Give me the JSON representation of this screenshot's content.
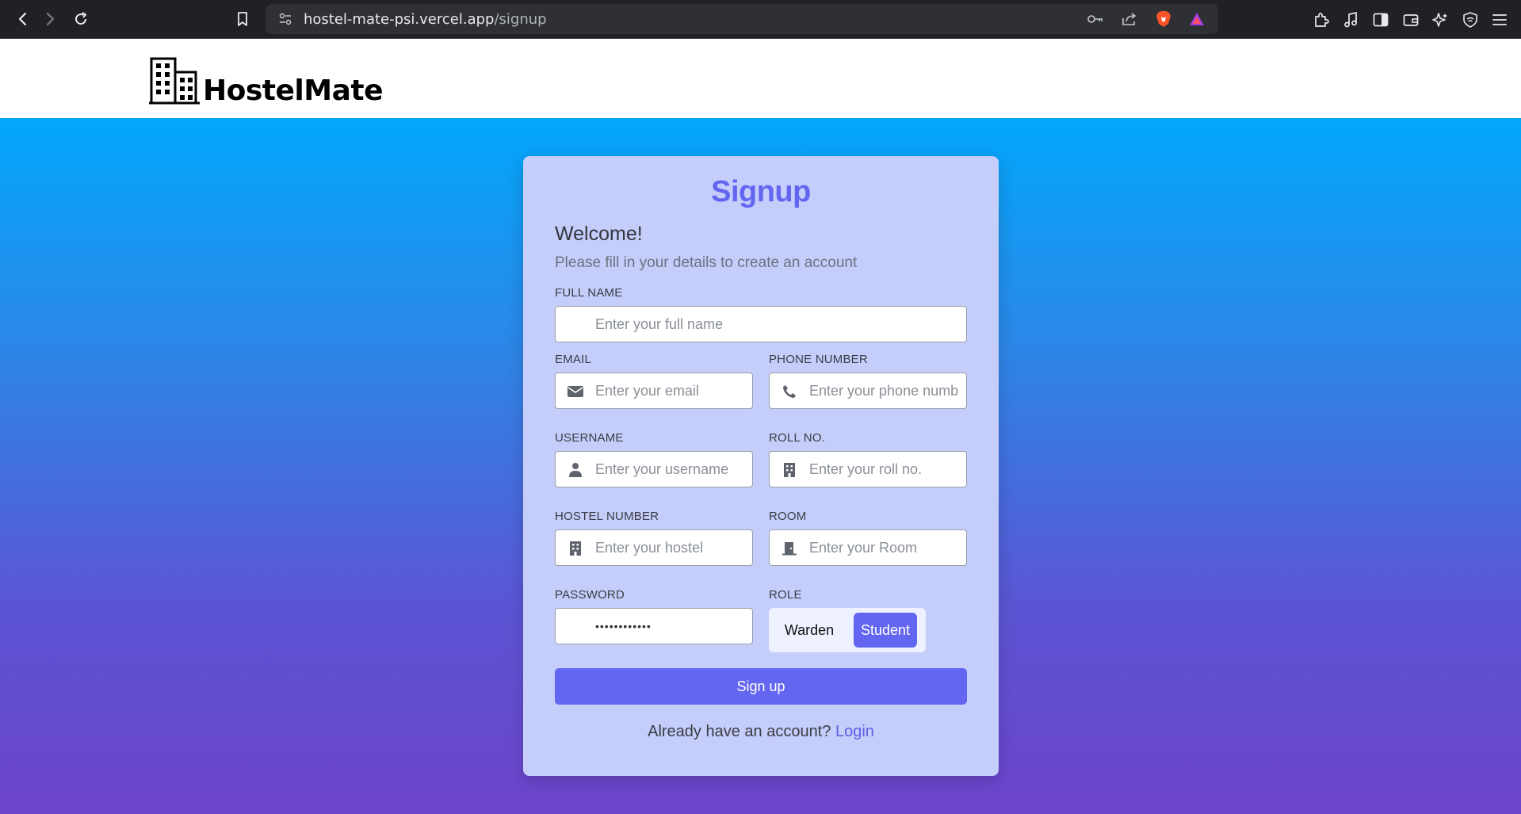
{
  "browser": {
    "url_domain": "hostel-mate-psi.vercel.app",
    "url_path": "/signup",
    "icons": [
      "back-icon",
      "forward-icon",
      "reload-icon",
      "bookmark-icon",
      "site-settings-icon",
      "key-icon",
      "share-icon",
      "brave-shield-icon",
      "brave-rewards-icon",
      "extensions-icon",
      "music-icon",
      "sidebar-icon",
      "wallet-icon",
      "leo-ai-icon",
      "vpn-icon",
      "menu-icon"
    ]
  },
  "header": {
    "logo_text": "HostelMate"
  },
  "form": {
    "title": "Signup",
    "welcome": "Welcome!",
    "subtitle": "Please fill in your details to create an account",
    "full_name": {
      "label": "FULL NAME",
      "placeholder": "Enter your full name",
      "value": ""
    },
    "email": {
      "label": "EMAIL",
      "placeholder": "Enter your email",
      "value": ""
    },
    "phone": {
      "label": "PHONE NUMBER",
      "placeholder": "Enter your phone number",
      "value": ""
    },
    "username": {
      "label": "USERNAME",
      "placeholder": "Enter your username",
      "value": ""
    },
    "roll": {
      "label": "ROLL NO.",
      "placeholder": "Enter your roll no.",
      "value": ""
    },
    "hostel": {
      "label": "HOSTEL NUMBER",
      "placeholder": "Enter your hostel",
      "value": ""
    },
    "room": {
      "label": "ROOM",
      "placeholder": "Enter your Room",
      "value": ""
    },
    "password": {
      "label": "PASSWORD",
      "value": "••••••••••••"
    },
    "role": {
      "label": "ROLE",
      "options": [
        "Warden",
        "Student"
      ],
      "selected": "Student"
    },
    "submit_label": "Sign up",
    "login_prompt": "Already have an account?",
    "login_link": "Login"
  },
  "colors": {
    "accent": "#6366f1",
    "card": "#c5cdfb",
    "gradient_top": "#02a7fb",
    "gradient_bottom": "#6d44cb"
  }
}
